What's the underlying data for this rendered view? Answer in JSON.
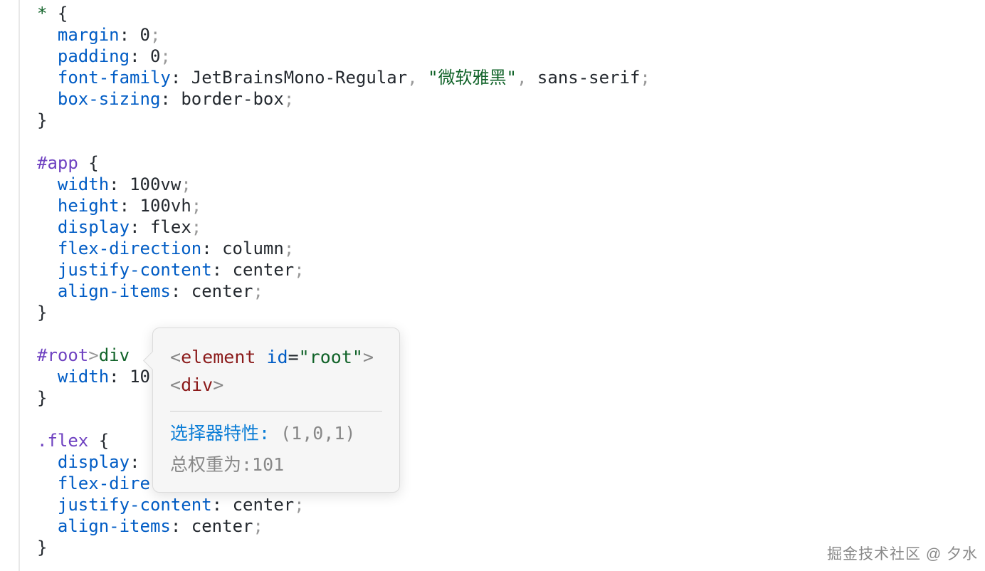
{
  "code": {
    "rule1": {
      "selector": "*",
      "decls": [
        {
          "prop": "margin",
          "val": "0"
        },
        {
          "prop": "padding",
          "val": "0"
        },
        {
          "prop": "font-family",
          "val_parts": [
            "JetBrainsMono-Regular",
            ",",
            " ",
            "\"微软雅黑\"",
            ",",
            " ",
            "sans-serif"
          ]
        },
        {
          "prop": "box-sizing",
          "val": "border-box"
        }
      ]
    },
    "rule2": {
      "selector": "#app",
      "decls": [
        {
          "prop": "width",
          "val": "100vw"
        },
        {
          "prop": "height",
          "val": "100vh"
        },
        {
          "prop": "display",
          "val": "flex"
        },
        {
          "prop": "flex-direction",
          "val": "column"
        },
        {
          "prop": "justify-content",
          "val": "center"
        },
        {
          "prop": "align-items",
          "val": "center"
        }
      ]
    },
    "rule3": {
      "selector_id": "#root",
      "selector_comb": ">",
      "selector_tag": "div",
      "decls": [
        {
          "prop": "width",
          "val_prefix": "10"
        }
      ]
    },
    "rule4": {
      "selector": ".flex",
      "decls": [
        {
          "prop": "display",
          "val_hidden": ""
        },
        {
          "prop_prefix": "flex-dire"
        },
        {
          "prop": "justify-content",
          "val": "center"
        },
        {
          "prop": "align-items",
          "val": "center"
        }
      ]
    }
  },
  "tooltip": {
    "line1_open": "<",
    "line1_tag": "element",
    "line1_attr": "id",
    "line1_eq": "=",
    "line1_val": "\"root\"",
    "line1_close": ">",
    "line2_open": "<",
    "line2_tag": "div",
    "line2_close": ">",
    "spec_label": "选择器特性:",
    "spec_value": "(1,0,1)",
    "weight_text": "总权重为:101"
  },
  "watermark": "掘金技术社区 @ 夕水"
}
